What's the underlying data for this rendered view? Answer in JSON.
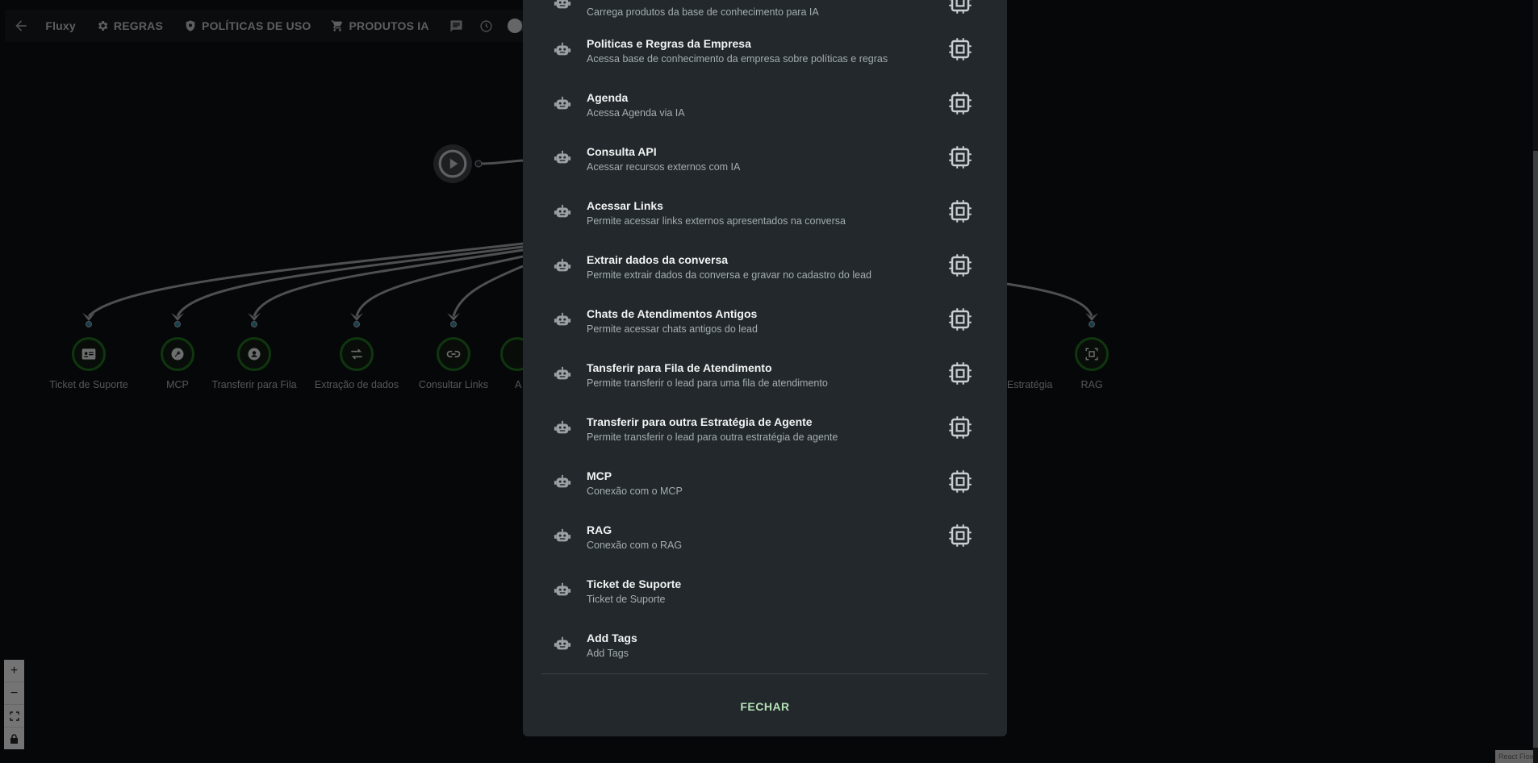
{
  "toolbar": {
    "brand": "Fluxy",
    "rules_label": "REGRAS",
    "policies_label": "POLÍTICAS DE USO",
    "products_label": "PRODUTOS IA"
  },
  "flow": {
    "nodes": [
      {
        "label": "Ticket de Suporte",
        "icon": "id-card-icon"
      },
      {
        "label": "MCP",
        "icon": "wrench-icon"
      },
      {
        "label": "Transferir para Fila",
        "icon": "person-pin-icon"
      },
      {
        "label": "Extração de dados",
        "icon": "swap-icon"
      },
      {
        "label": "Consultar Links",
        "icon": "link-icon"
      },
      {
        "label": "A",
        "icon": "partial-icon"
      },
      {
        "label": "Estratégia",
        "icon": "none"
      },
      {
        "label": "RAG",
        "icon": "frame-icon"
      }
    ],
    "attribution": "React Flow"
  },
  "modal": {
    "items": [
      {
        "title": "",
        "desc": "Carrega produtos da base de conhecimento para IA",
        "chip": true
      },
      {
        "title": "Politicas e Regras da Empresa",
        "desc": "Acessa base de conhecimento da empresa sobre políticas e regras",
        "chip": true
      },
      {
        "title": "Agenda",
        "desc": "Acessa Agenda via IA",
        "chip": true
      },
      {
        "title": "Consulta API",
        "desc": "Acessar recursos externos com IA",
        "chip": true
      },
      {
        "title": "Acessar Links",
        "desc": "Permite acessar links externos apresentados na conversa",
        "chip": true
      },
      {
        "title": "Extrair dados da conversa",
        "desc": "Permite extrair dados da conversa e gravar no cadastro do lead",
        "chip": true
      },
      {
        "title": "Chats de Atendimentos Antigos",
        "desc": "Permite acessar chats antigos do lead",
        "chip": true
      },
      {
        "title": "Tansferir para Fila de Atendimento",
        "desc": "Permite transferir o lead para uma fila de atendimento",
        "chip": true
      },
      {
        "title": "Transferir para outra Estratégia de Agente",
        "desc": "Permite transferir o lead para outra estratégia de agente",
        "chip": true
      },
      {
        "title": "MCP",
        "desc": "Conexão com o MCP",
        "chip": true
      },
      {
        "title": "RAG",
        "desc": "Conexão com o RAG",
        "chip": true
      },
      {
        "title": "Ticket de Suporte",
        "desc": "Ticket de Suporte",
        "chip": false
      },
      {
        "title": "Add Tags",
        "desc": "Add Tags",
        "chip": false
      }
    ],
    "close_label": "FECHAR"
  },
  "colors": {
    "canvas_bg": "#0c0f11",
    "modal_bg": "#22282c",
    "node_ring": "#1f6d1f",
    "accent_text": "#b5e0b5"
  }
}
